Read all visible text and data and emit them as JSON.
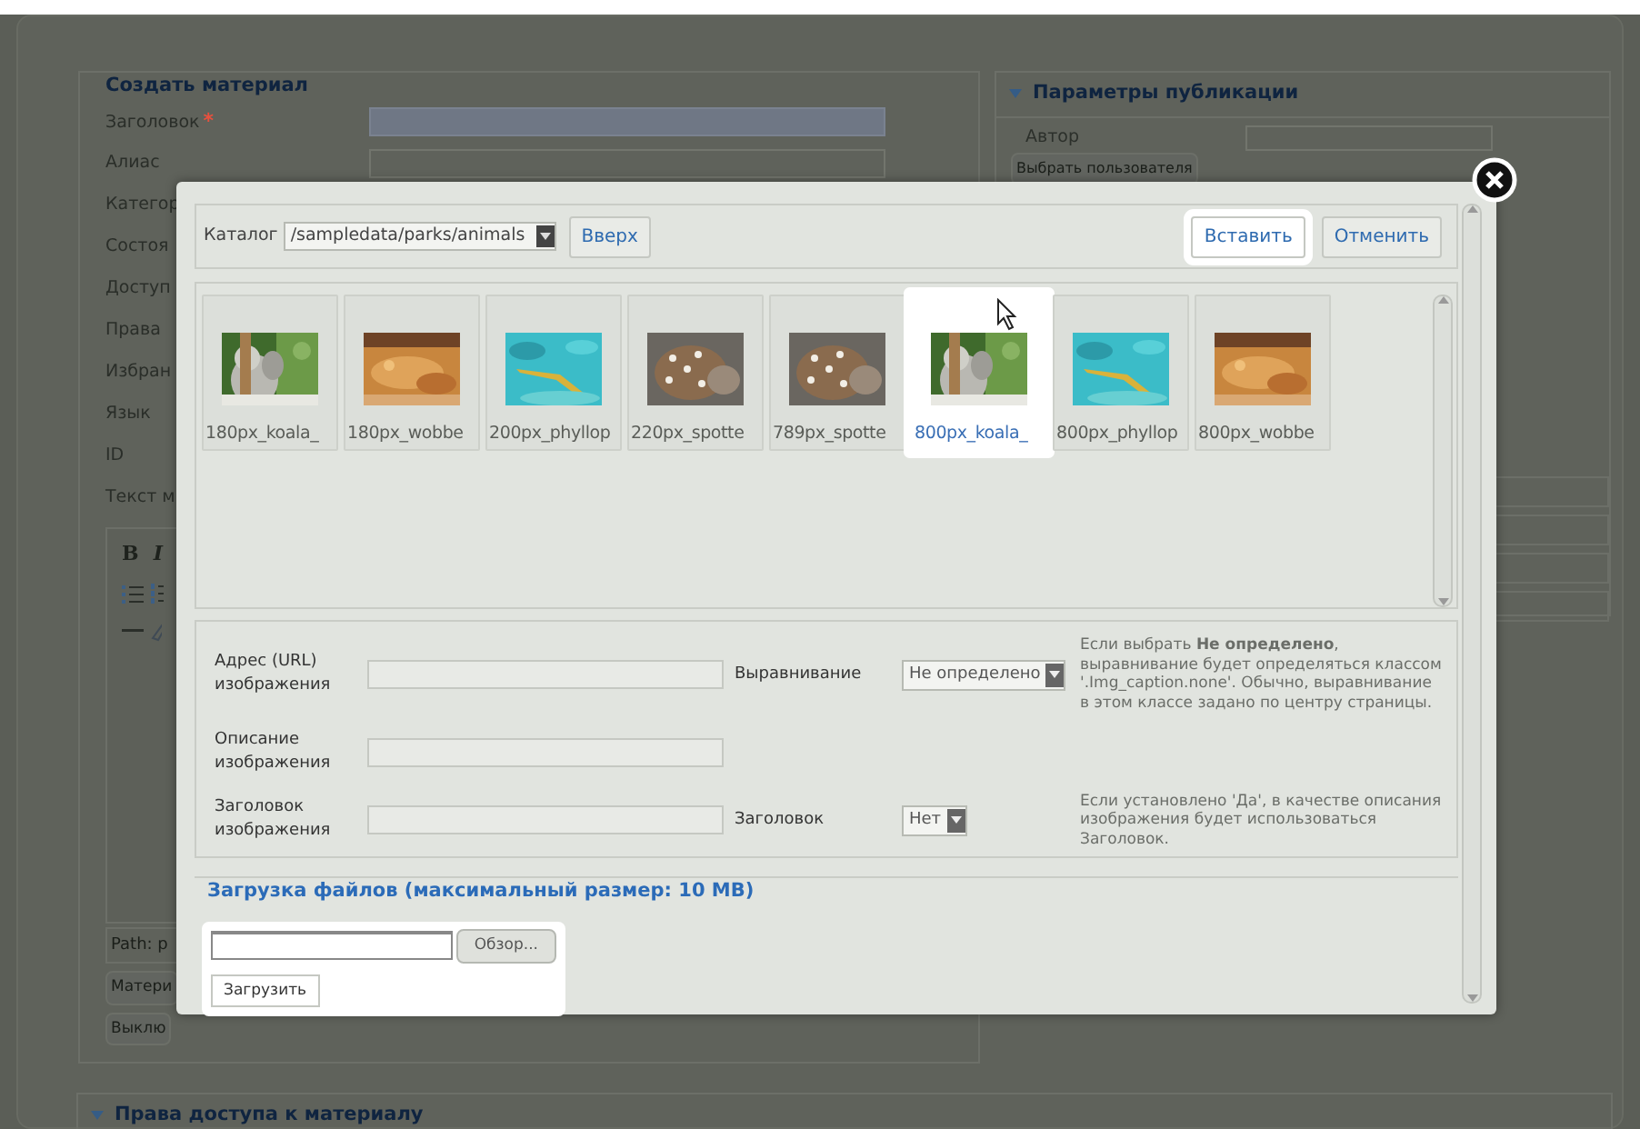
{
  "background_form": {
    "legend": "Создать материал",
    "fields": [
      {
        "label": "Заголовок",
        "marker": "*",
        "kind": "field",
        "focused": true
      },
      {
        "label": "Алиас",
        "kind": "field",
        "focused": false
      },
      {
        "label": "Категор",
        "kind": "label"
      },
      {
        "label": "Состоя",
        "kind": "label"
      },
      {
        "label": "Доступ",
        "kind": "label"
      },
      {
        "label": "Права",
        "kind": "label"
      },
      {
        "label": "Избран",
        "kind": "label"
      },
      {
        "label": "Язык",
        "kind": "label"
      },
      {
        "label": "ID",
        "kind": "label"
      },
      {
        "label": "Текст м",
        "kind": "label"
      }
    ],
    "editor": {
      "bold": "B",
      "italic": "I",
      "path": "Path: p"
    },
    "buttons": [
      "Матери",
      "Выклю"
    ]
  },
  "publish_panel": {
    "title": "Параметры публикации",
    "author_label": "Автор",
    "choose_button": "Выбрать пользователя"
  },
  "access_panel": {
    "title": "Права доступа к материалу"
  },
  "modal": {
    "toolbar": {
      "label": "Каталог",
      "folder": "/sampledata/parks/animals",
      "up_button": "Вверх",
      "actions": [
        {
          "label": "Вставить",
          "highlighted": true
        },
        {
          "label": "Отменить",
          "highlighted": false
        }
      ]
    },
    "images": [
      {
        "name": "180px_koala_",
        "kind": "koala",
        "selected": false
      },
      {
        "name": "180px_wobbe",
        "kind": "wobbegong",
        "selected": false
      },
      {
        "name": "200px_phyllop",
        "kind": "seadragon",
        "selected": false
      },
      {
        "name": "220px_spotte",
        "kind": "quoll",
        "selected": false
      },
      {
        "name": "789px_spotte",
        "kind": "quoll",
        "selected": false
      },
      {
        "name": "800px_koala_",
        "kind": "koala",
        "selected": true
      },
      {
        "name": "800px_phyllop",
        "kind": "seadragon",
        "selected": false
      },
      {
        "name": "800px_wobbe",
        "kind": "wobbegong",
        "selected": false
      }
    ],
    "form": [
      {
        "label": "Адрес (URL) изображения",
        "option_label": "Выравнивание",
        "option_value": "Не определено",
        "hint": "Если выбрать **Не определено**, выравнивание будет определяться классом '.Img_caption.none'. Обычно, выравнивание в этом классе задано по центру страницы."
      },
      {
        "label": "Описание изображения"
      },
      {
        "label": "Заголовок изображения",
        "option_label": "Заголовок",
        "option_value": "Нет",
        "hint": "Если установлено 'Да', в качестве описания изображения будет использоваться Заголовок."
      }
    ],
    "upload": {
      "legend": "Загрузка файлов (максимальный размер: 10 MB)",
      "browse_button": "Обзор...",
      "upload_button": "Загрузить",
      "highlighted": true
    }
  }
}
